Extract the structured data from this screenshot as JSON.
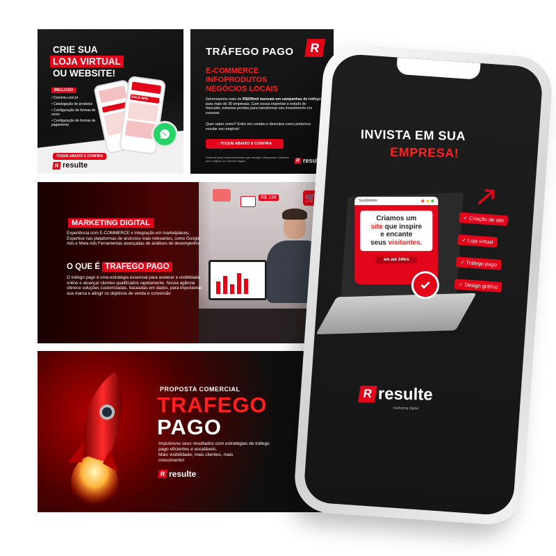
{
  "card1": {
    "title1": "CRIE SUA",
    "title2": "LOJA VIRTUAL",
    "title3": "OU WEBSITE!",
    "included_label": "INCLUSO",
    "items": [
      "Domínio.com.br",
      "Catalogação de produtos",
      "Configuração de formas de envio",
      "Configuração de formas de pagamento"
    ],
    "cta": "TOQUE ABAIXO E CONFIRA",
    "badge": "SALE",
    "badge_value": "50%",
    "logo_text": "resulte"
  },
  "card2": {
    "title": "TRÁFEGO PAGO",
    "subtitle1": "E-COMMERCE",
    "subtitle2": "INFOPRODUTOS",
    "subtitle3": "NEGÓCIOS LOCAIS",
    "p1a": "Gerenciamos mais de ",
    "p1b": "R$200mil mensais em campanhas de tráfego",
    "p1c": " para mais de 30 empresas. Com nossa expertise e estudo de mercado, estamos prontos para transformar seu investimento em sucesso.",
    "p2": "Quer saber como? Entre em contato e descubra como podemos escalar seu negócio!",
    "cta": "TOQUE ABAIXO E CONFIRA",
    "footnote": "Somente para empreendedores que desejam ultrapassar a barreira dos 4 dígitos no mercado digital",
    "logo_text": "resulte"
  },
  "card3": {
    "label1": "MARKETING DIGITAL",
    "p1": "Experiência com E-COMMERCE e integração em marketplaces; Expertise nas plataformas de anúncios mais relevantes, como Google Ads e Meta Ads Ferramentas avançadas de análises de desempenho",
    "label2a": "O QUE É",
    "label2b": "TRAFEGO PAGO",
    "p2": "O tráfego pago é uma estratégia essencial para acelerar a visibilidade online e alcançar clientes qualificados rapidamente. Nossa agência oferece soluções customizadas, baseadas em dados, para impulsionar sua marca e atingir os objetivos de venda e conversão",
    "price_tag": "R$ 139"
  },
  "card4": {
    "small_title": "PROPOSTA COMERCIAL",
    "title1": "TRAFEGO",
    "title2": "PAGO",
    "p1": "Impulsione seus resultados com estratégias de tráfego pago eficientes e escaláveis.",
    "p2": "Mais visibilidade, mais clientes, mais crescimento!",
    "logo_text": "resulte"
  },
  "phone": {
    "title1": "INVISTA EM SUA",
    "title2": "EMPRESA!",
    "window_label": "SeuWebsite",
    "pitch1": "Criamos um",
    "pitch2": "site",
    "pitch3": "que inspire",
    "pitch4": "e encante",
    "pitch5": "seus",
    "pitch6": "visitantes.",
    "deadline": "em até 24hrs",
    "services": [
      "Criação de site",
      "Loja virtual",
      "Tráfego pago",
      "Design gráfico"
    ],
    "logo_text": "resulte",
    "logo_tagline": "marketing digital"
  },
  "colors": {
    "accent": "#e3061a",
    "dark": "#151515",
    "light": "#ffffff"
  }
}
